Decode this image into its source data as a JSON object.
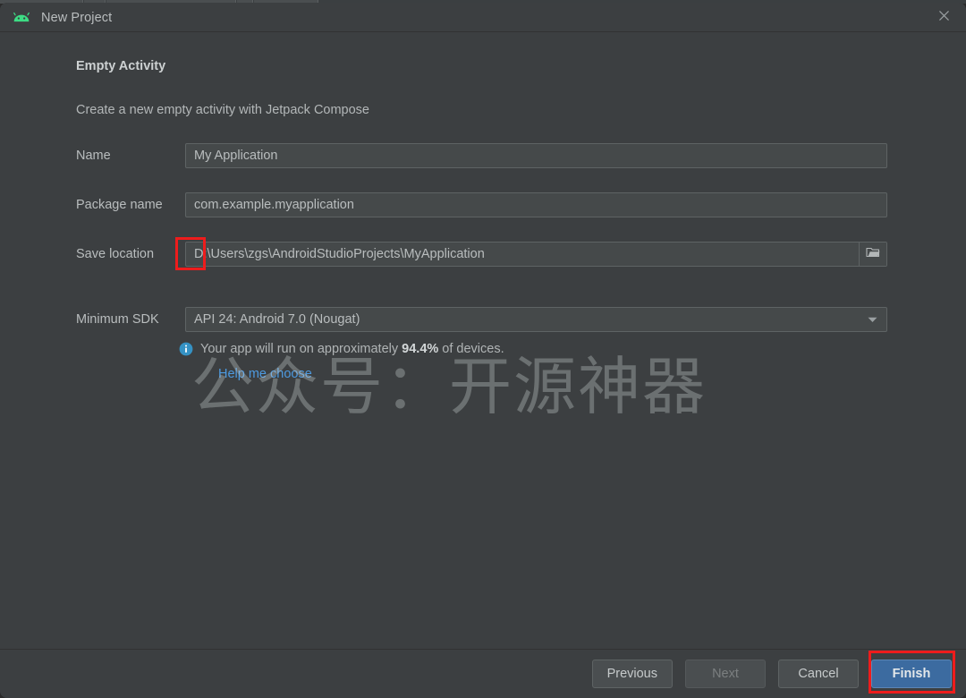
{
  "window": {
    "title": "New Project",
    "app_icon": "android-robot-icon",
    "close_icon": "close-icon"
  },
  "form": {
    "section_title": "Empty Activity",
    "section_description": "Create a new empty activity with Jetpack Compose",
    "fields": [
      {
        "label": "Name",
        "value": "My Application"
      },
      {
        "label": "Package name",
        "value": "com.example.myapplication"
      },
      {
        "label": "Save location",
        "value": "D:\\Users\\zgs\\AndroidStudioProjects\\MyApplication",
        "trailing_icon": "folder-icon"
      },
      {
        "label": "Minimum SDK",
        "value": "API 24: Android 7.0 (Nougat)",
        "trailing_icon": "chevron-down-icon"
      }
    ],
    "info": {
      "icon": "info-icon",
      "text_before": "Your app will run on approximately ",
      "percent": "94.4%",
      "text_after": " of devices.",
      "help_link": "Help me choose"
    }
  },
  "watermark": {
    "text": "公众号：开源神器"
  },
  "footer": {
    "buttons": [
      {
        "label": "Previous",
        "state": "enabled",
        "style": "secondary"
      },
      {
        "label": "Next",
        "state": "disabled",
        "style": "secondary"
      },
      {
        "label": "Cancel",
        "state": "enabled",
        "style": "secondary"
      },
      {
        "label": "Finish",
        "state": "enabled",
        "style": "primary"
      }
    ]
  },
  "annotations": {
    "highlight_color": "#ee1c1c",
    "boxes": [
      {
        "name": "drive-letter-highlight",
        "target": "D:\\"
      },
      {
        "name": "finish-button-highlight",
        "target": "Finish"
      }
    ]
  },
  "colors": {
    "dialog_background": "#3c3f41",
    "input_background": "#45494a",
    "primary_button": "#3c6ba0",
    "link": "#4d9ae0",
    "android_green": "#3ddc84"
  }
}
